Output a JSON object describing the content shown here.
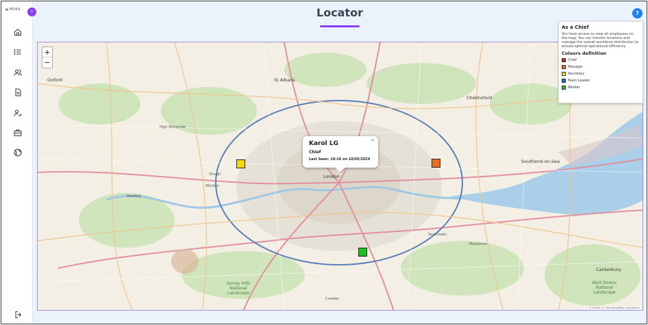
{
  "app": {
    "brand": "MOEA",
    "expand_glyph": "›",
    "help_glyph": "?"
  },
  "page": {
    "title": "Locator"
  },
  "sidebar": {
    "items": [
      {
        "name": "home-icon"
      },
      {
        "name": "list-icon"
      },
      {
        "name": "users-icon"
      },
      {
        "name": "document-icon"
      },
      {
        "name": "user-check-icon"
      },
      {
        "name": "briefcase-icon"
      },
      {
        "name": "globe-icon"
      }
    ],
    "logout_icon": "logout-icon"
  },
  "map": {
    "zoom_in": "+",
    "zoom_out": "−",
    "attribution": "© Leaflet | © OpenStreetMap contributors",
    "places": {
      "oxford": "Oxford",
      "st_albans": "St Albans",
      "chelmsford": "Chelmsford",
      "london": "London",
      "southend": "Southend-on-Sea",
      "canterbury": "Canterbury",
      "high_wycombe": "High Wycombe",
      "slough": "Slough",
      "windsor": "Windsor",
      "crawley": "Crawley",
      "reading": "Reading",
      "kent_downs": "Kent Downs National Landscape",
      "surrey_hills": "Surrey Hills National Landscape",
      "maidstone": "Maidstone",
      "sevenoaks": "Sevenoaks"
    }
  },
  "popup": {
    "close": "×",
    "name": "Karol LG",
    "role": "Chief",
    "last_seen_label": "Last Seen:",
    "last_seen_value": "18:16 on 10/05/2024"
  },
  "info_panel": {
    "title": "As a Chief",
    "text": "You have access to view all employees on the map. You can monitor locations and manage the overall workforce distribution to ensure optimal operational efficiency.",
    "legend_title": "Colours definition",
    "legend": [
      {
        "label": "Chief",
        "color": "#d71f27"
      },
      {
        "label": "Manager",
        "color": "#f06a1a"
      },
      {
        "label": "Secretary",
        "color": "#f5e11a"
      },
      {
        "label": "Team Leader",
        "color": "#1f6fd0"
      },
      {
        "label": "Worker",
        "color": "#27c023"
      }
    ]
  },
  "markers": {
    "secretary_color": "#f5d90e",
    "manager_color": "#ee6a1c",
    "worker_color": "#1fc01f",
    "chief_color": "#b01e24"
  }
}
